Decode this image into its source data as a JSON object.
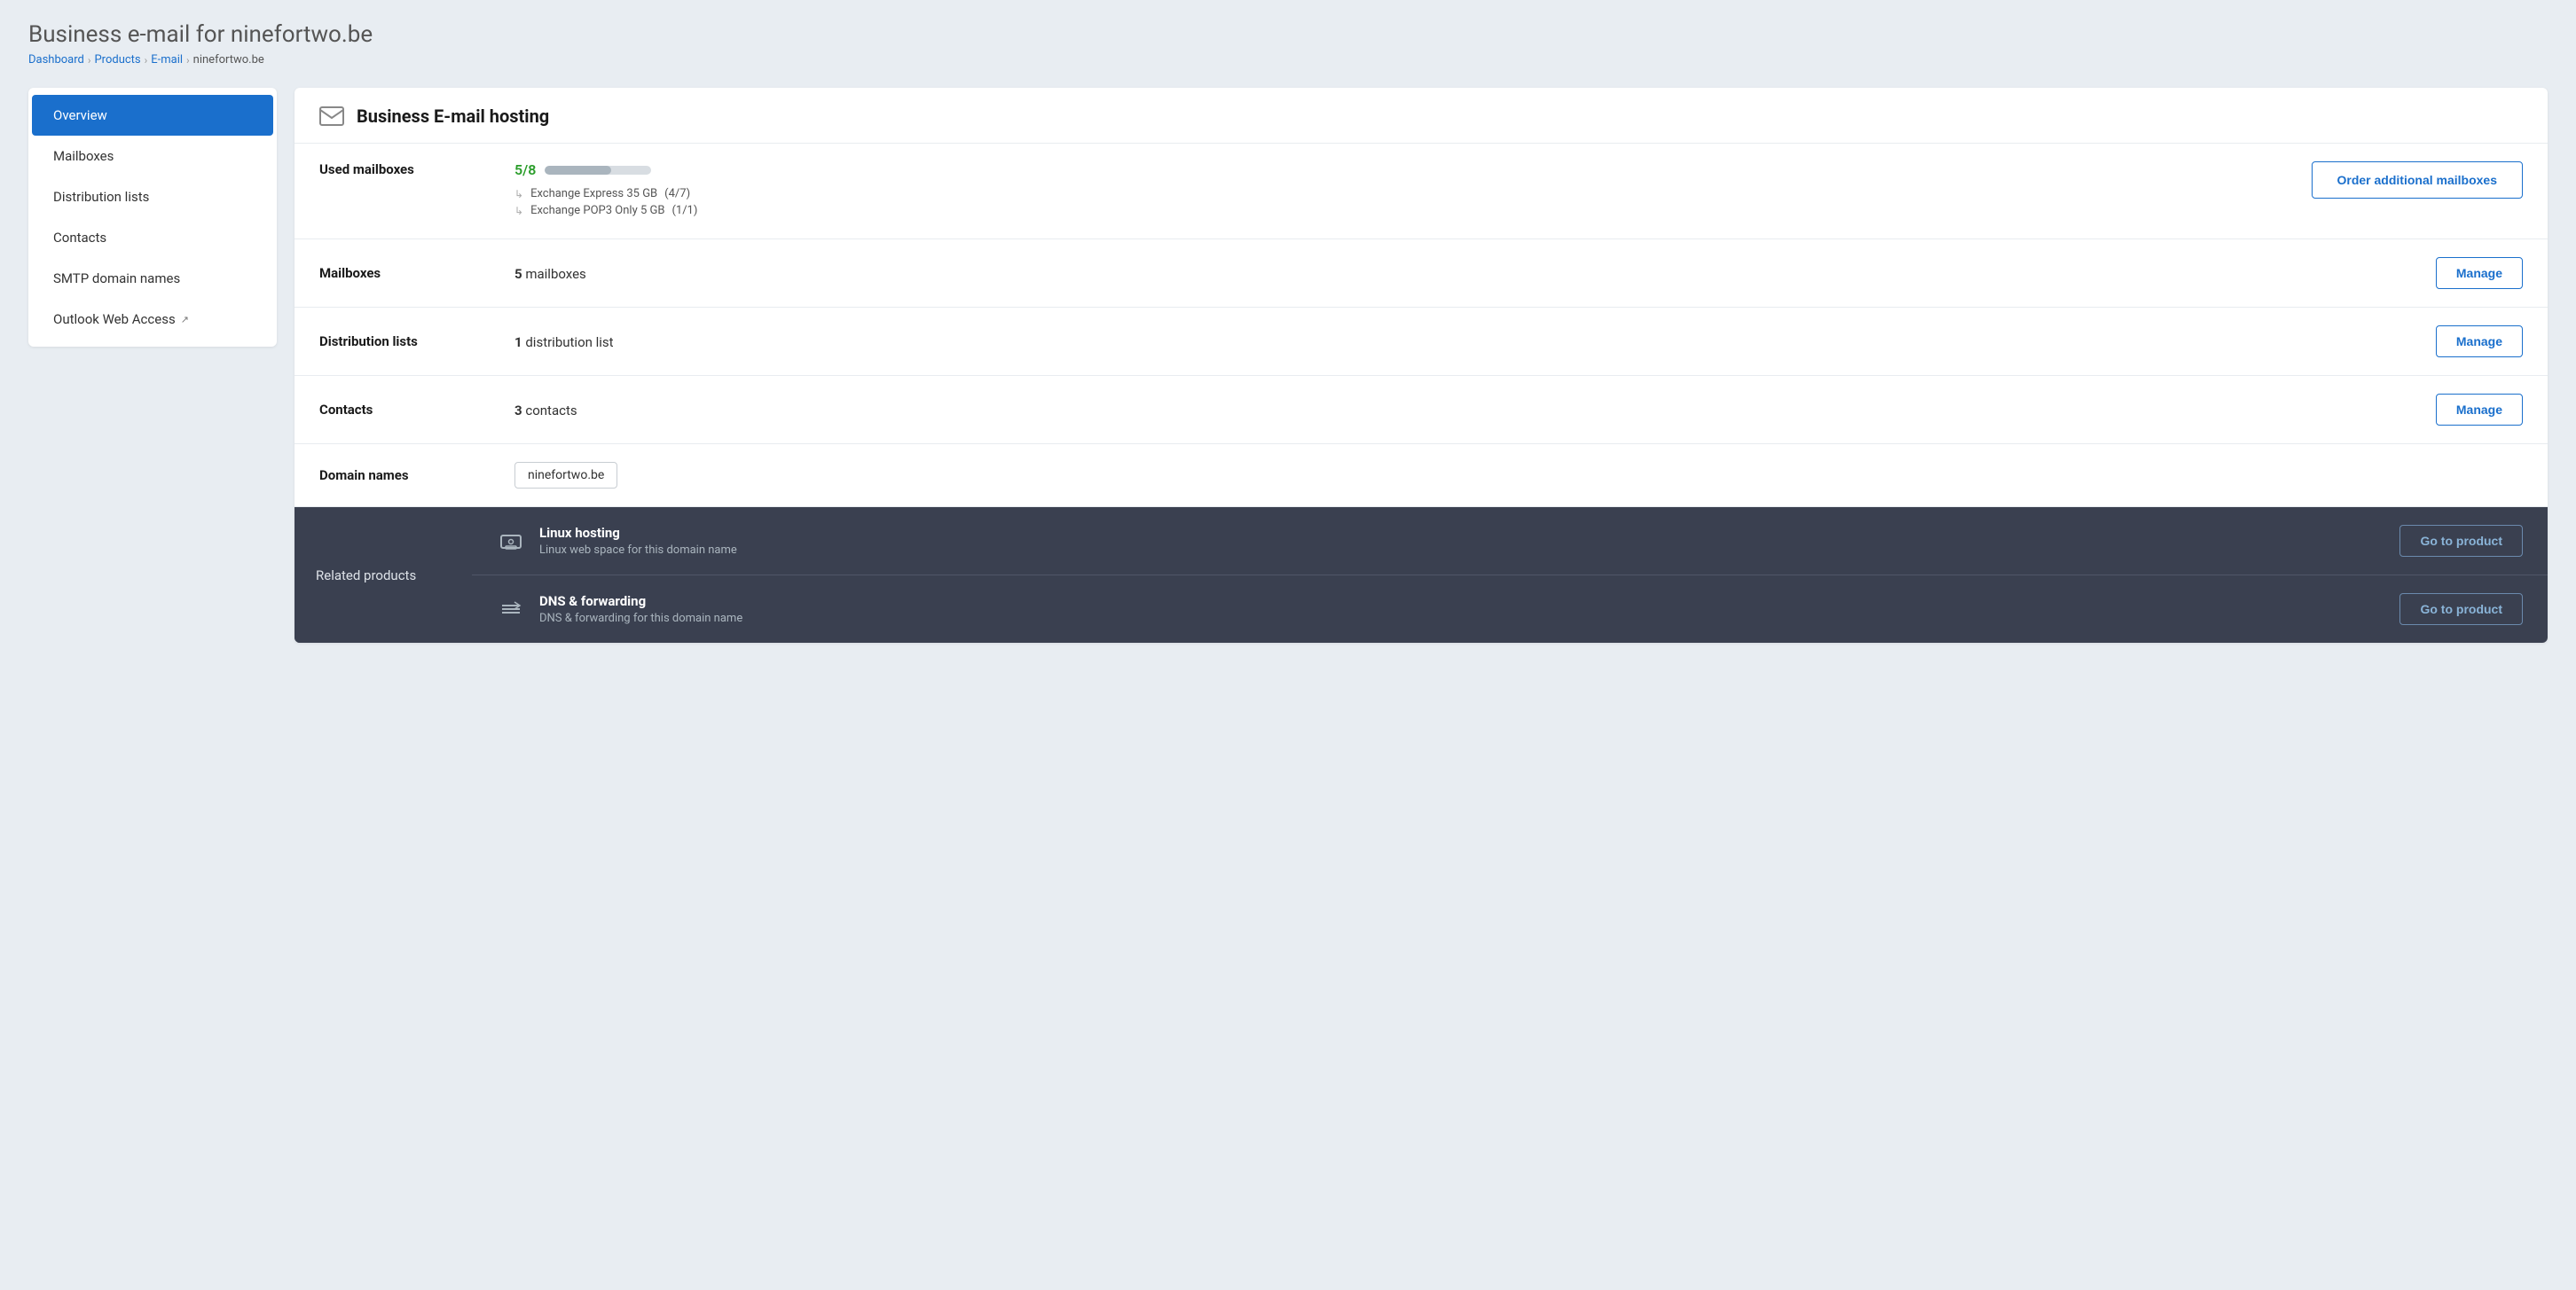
{
  "page": {
    "title_bold": "Business e-mail for",
    "title_domain": "ninefortwo.be"
  },
  "breadcrumb": {
    "items": [
      {
        "label": "Dashboard",
        "href": "#"
      },
      {
        "label": "Products",
        "href": "#"
      },
      {
        "label": "E-mail",
        "href": "#"
      }
    ],
    "current": "ninefortwo.be"
  },
  "sidebar": {
    "items": [
      {
        "label": "Overview",
        "active": true,
        "external": false
      },
      {
        "label": "Mailboxes",
        "active": false,
        "external": false
      },
      {
        "label": "Distribution lists",
        "active": false,
        "external": false
      },
      {
        "label": "Contacts",
        "active": false,
        "external": false
      },
      {
        "label": "SMTP domain names",
        "active": false,
        "external": false
      },
      {
        "label": "Outlook Web Access",
        "active": false,
        "external": true
      }
    ]
  },
  "content": {
    "title": "Business E-mail hosting",
    "sections": {
      "used_mailboxes": {
        "label": "Used mailboxes",
        "used": "5",
        "total": "8",
        "fraction": "5/8",
        "progress_pct": 62,
        "sub_items": [
          {
            "label": "Exchange Express 35 GB",
            "detail": "(4/7)"
          },
          {
            "label": "Exchange POP3 Only 5 GB",
            "detail": "(1/1)"
          }
        ],
        "action_label": "Order additional mailboxes"
      },
      "mailboxes": {
        "label": "Mailboxes",
        "value_bold": "5",
        "value_text": "mailboxes",
        "action_label": "Manage"
      },
      "distribution_lists": {
        "label": "Distribution lists",
        "value_bold": "1",
        "value_text": "distribution list",
        "action_label": "Manage"
      },
      "contacts": {
        "label": "Contacts",
        "value_bold": "3",
        "value_text": "contacts",
        "action_label": "Manage"
      },
      "domain_names": {
        "label": "Domain names",
        "domain": "ninefortwo.be"
      }
    },
    "related_products": {
      "label": "Related products",
      "items": [
        {
          "name": "Linux hosting",
          "description": "Linux web space for this domain name",
          "action_label": "Go to product",
          "icon": "server"
        },
        {
          "name": "DNS & forwarding",
          "description": "DNS & forwarding for this domain name",
          "action_label": "Go to product",
          "icon": "dns"
        }
      ]
    }
  }
}
